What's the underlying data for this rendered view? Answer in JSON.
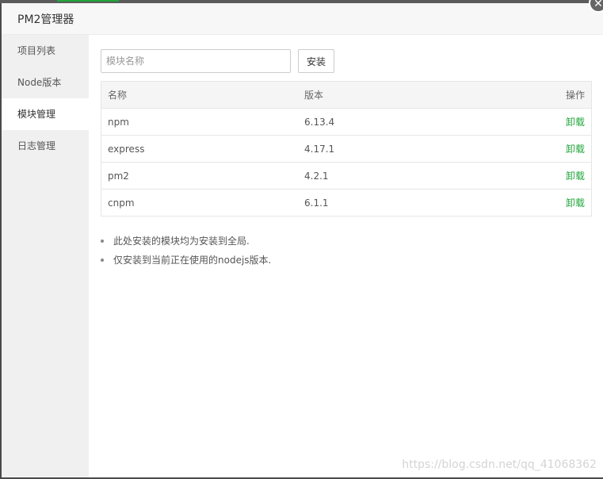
{
  "window": {
    "title": "PM2管理器",
    "close_glyph": "✕"
  },
  "sidebar": {
    "items": [
      {
        "label": "项目列表",
        "active": false
      },
      {
        "label": "Node版本",
        "active": false
      },
      {
        "label": "模块管理",
        "active": true
      },
      {
        "label": "日志管理",
        "active": false
      }
    ]
  },
  "search": {
    "placeholder": "模块名称",
    "value": "",
    "install_label": "安装"
  },
  "table": {
    "headers": {
      "name": "名称",
      "version": "版本",
      "operation": "操作"
    },
    "rows": [
      {
        "name": "npm",
        "version": "6.13.4",
        "action": "卸载"
      },
      {
        "name": "express",
        "version": "4.17.1",
        "action": "卸载"
      },
      {
        "name": "pm2",
        "version": "4.2.1",
        "action": "卸载"
      },
      {
        "name": "cnpm",
        "version": "6.1.1",
        "action": "卸载"
      }
    ]
  },
  "tips": [
    "此处安装的模块均为安装到全局.",
    "仅安装到当前正在使用的nodejs版本."
  ],
  "watermark": "https://blog.csdn.net/qq_41068362",
  "colors": {
    "accent": "#20a53a",
    "sidebar_bg": "#f0f0f0",
    "header_bg": "#f5f5f5"
  }
}
